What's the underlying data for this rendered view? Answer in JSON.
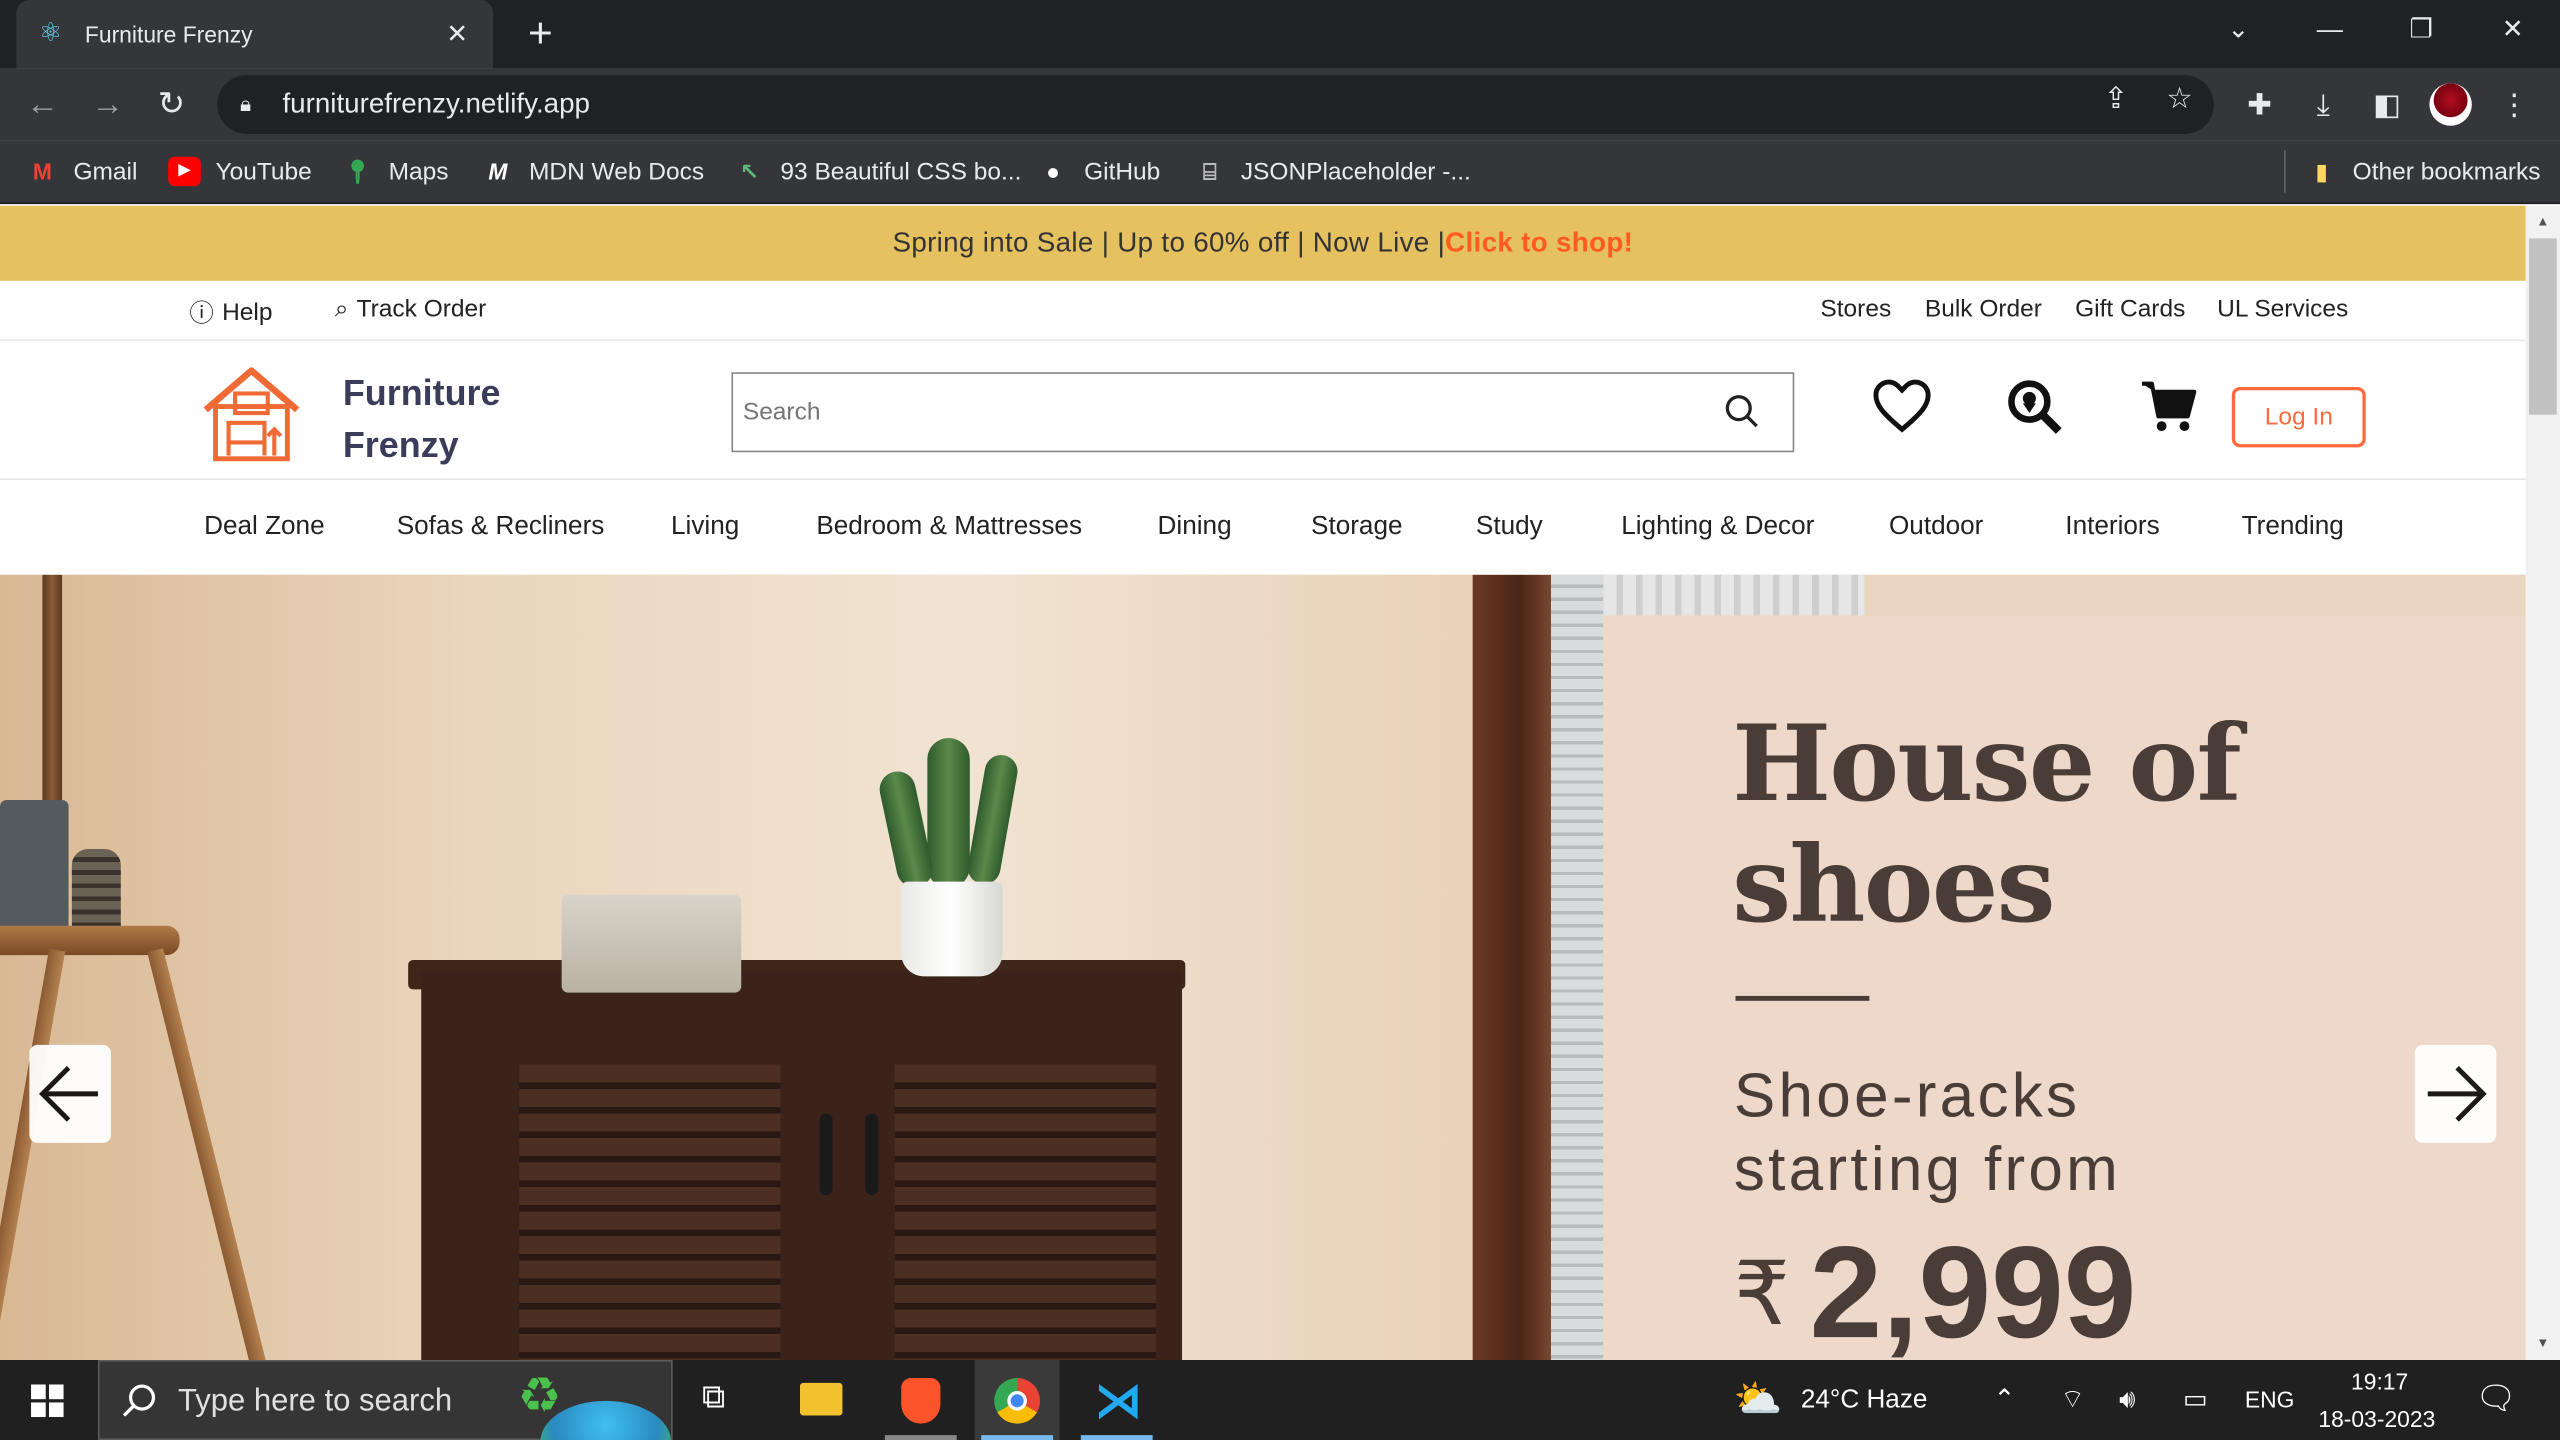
{
  "browser": {
    "tab_title": "Furniture Frenzy",
    "tab_close": "✕",
    "new_tab": "+",
    "url": "furniturefrenzy.netlify.app",
    "bookmarks": [
      {
        "label": "Gmail",
        "icon": "gmail-icon"
      },
      {
        "label": "YouTube",
        "icon": "youtube-icon"
      },
      {
        "label": "Maps",
        "icon": "maps-icon"
      },
      {
        "label": "MDN Web Docs",
        "icon": "mdn-icon"
      },
      {
        "label": "93 Beautiful CSS bo...",
        "icon": "css-icon"
      },
      {
        "label": "GitHub",
        "icon": "github-icon"
      },
      {
        "label": "JSONPlaceholder -...",
        "icon": "json-icon"
      }
    ],
    "other_bookmarks": "Other bookmarks"
  },
  "site": {
    "promo": {
      "text": "Spring into Sale | Up to 60% off | Now Live |",
      "cta": "Click to shop!"
    },
    "utility_left": [
      {
        "label": "Help",
        "icon": "help-icon"
      },
      {
        "label": "Track Order",
        "icon": "track-order-icon"
      }
    ],
    "utility_right": [
      "Stores",
      "Bulk Order",
      "Gift Cards",
      "UL Services"
    ],
    "brand": "Furniture Frenzy",
    "search_placeholder": "Search",
    "login_label": "Log In",
    "categories": [
      "Deal Zone",
      "Sofas & Recliners",
      "Living",
      "Bedroom & Mattresses",
      "Dining",
      "Storage",
      "Study",
      "Lighting & Decor",
      "Outdoor",
      "Interiors",
      "Trending"
    ],
    "hero": {
      "title": "House of shoes",
      "subtitle": "Shoe-racks starting from",
      "currency": "₹",
      "price": "2,999"
    },
    "colors": {
      "promo_bg": "#e6c15f",
      "accent": "#ff6a3d",
      "brand_text": "#3b3c5a"
    }
  },
  "taskbar": {
    "search_placeholder": "Type here to search",
    "weather": "24°C  Haze",
    "lang": "ENG",
    "time": "19:17",
    "date": "18-03-2023"
  }
}
